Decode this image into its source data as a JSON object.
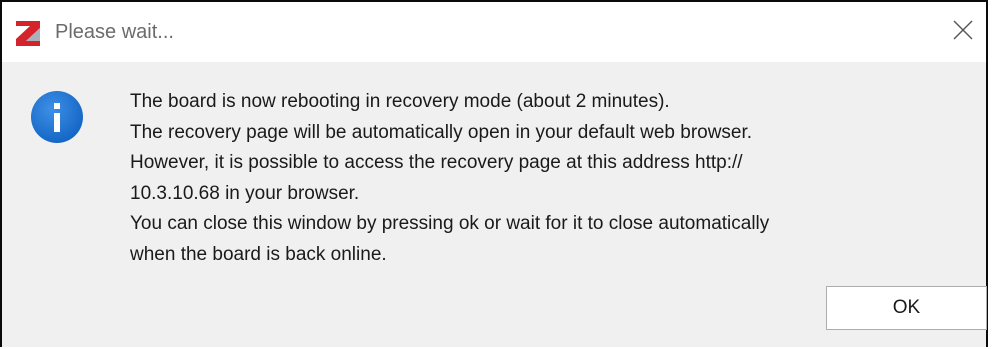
{
  "window": {
    "title": "Please wait...",
    "app_icon": "red-z-app-icon",
    "close_icon": "close-x-icon"
  },
  "dialog": {
    "icon": "info-icon",
    "message_lines": [
      "The board is now rebooting in recovery mode (about 2 minutes).",
      "The recovery page will be automatically open in your default web browser.",
      "However, it is possible to access the recovery page at this address http://",
      "10.3.10.68 in your browser.",
      "You can close this window by pressing ok or wait for it to close automatically",
      "when the board is back online."
    ],
    "ok_label": "OK"
  },
  "colors": {
    "titlebar_bg": "#ffffff",
    "body_bg": "#f0f0f0",
    "info_blue": "#1e73d2",
    "app_icon_red": "#d4232b"
  }
}
